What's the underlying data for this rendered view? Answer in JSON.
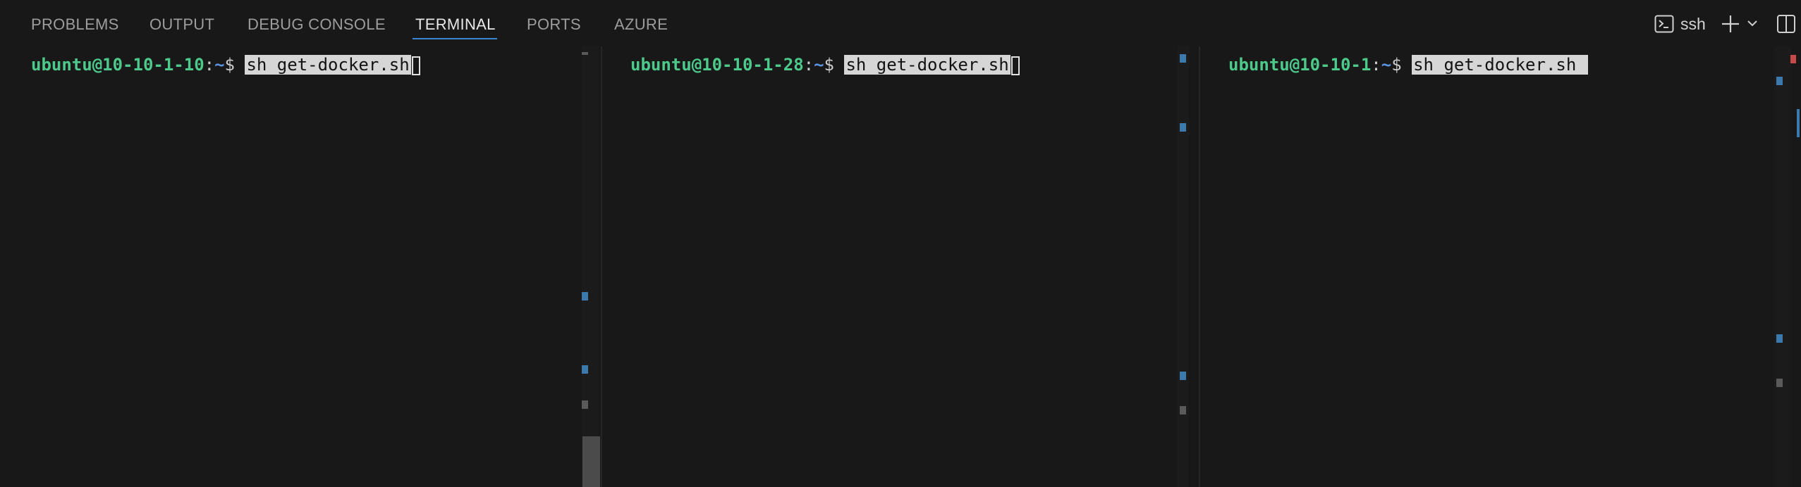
{
  "panel": {
    "tabs": [
      {
        "label": "PROBLEMS"
      },
      {
        "label": "OUTPUT"
      },
      {
        "label": "DEBUG CONSOLE"
      },
      {
        "label": "TERMINAL",
        "active": true
      },
      {
        "label": "PORTS"
      },
      {
        "label": "AZURE"
      }
    ],
    "terminal_profile": "ssh",
    "icons": [
      "terminal-icon",
      "plus-icon",
      "chevron-down-icon",
      "split-panel-icon"
    ]
  },
  "terminals": [
    {
      "user_host": "ubuntu@10-10-1-10",
      "colon": ":",
      "path": "~",
      "dollar": "$ ",
      "command": "sh get-docker.sh"
    },
    {
      "user_host": "ubuntu@10-10-1-28",
      "colon": ":",
      "path": "~",
      "dollar": "$ ",
      "command": "sh get-docker.sh"
    },
    {
      "user_host": "ubuntu@10-10-1",
      "colon": ":",
      "path": "~",
      "dollar": "$ ",
      "command": "sh get-docker.sh "
    }
  ],
  "colors": {
    "background": "#181818",
    "active_tab_underline": "#3b86d6",
    "prompt_user": "#4dc98b",
    "prompt_path": "#5b95e0",
    "overview_marker": "#3c79ad",
    "error_marker": "#c74949"
  }
}
